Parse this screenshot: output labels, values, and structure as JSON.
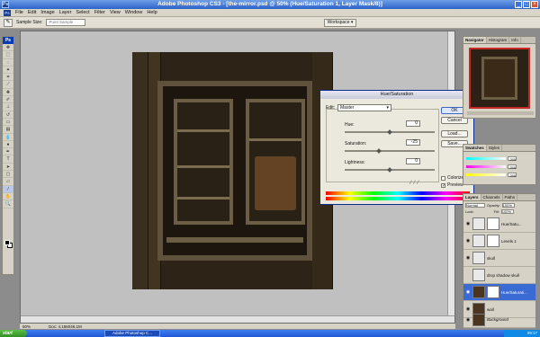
{
  "titlebar": {
    "logo": "Ps",
    "title": "Adobe Photoshop CS3 - [the-mirror.psd @ 50% (Hue/Saturation 1, Layer Mask/8)]"
  },
  "menus": [
    "File",
    "Edit",
    "Image",
    "Layer",
    "Select",
    "Filter",
    "View",
    "Window",
    "Help"
  ],
  "options": {
    "sample_size_label": "Sample Size:",
    "sample_size_value": "Point Sample",
    "workspace": "Workspace ▾"
  },
  "toolbox": {
    "header": "Ps"
  },
  "dialog": {
    "title": "Hue/Saturation",
    "edit_label": "Edit:",
    "edit_value": "Master",
    "hue_label": "Hue:",
    "hue_value": "0",
    "saturation_label": "Saturation:",
    "saturation_value": "-25",
    "lightness_label": "Lightness:",
    "lightness_value": "0",
    "ok": "OK",
    "cancel": "Cancel",
    "load": "Load...",
    "save": "Save...",
    "colorize": "Colorize",
    "preview": "Preview",
    "colorize_checked": false,
    "preview_checked": true
  },
  "navigator_panel": {
    "tabs": [
      "Navigator",
      "Histogram",
      "Info"
    ]
  },
  "color_panel": {
    "tabs": [
      "Swatches",
      "Styles"
    ],
    "values": [
      "255",
      "255",
      "255"
    ]
  },
  "layers_panel": {
    "tabs": [
      "Layers",
      "Channels",
      "Paths"
    ],
    "mode": "Normal",
    "opacity_label": "Opacity:",
    "opacity": "100%",
    "lock_label": "Lock:",
    "fill_label": "Fill:",
    "fill": "100%",
    "layers": [
      {
        "name": "Hue/Satu...",
        "selected": false
      },
      {
        "name": "Levels 1",
        "selected": false
      },
      {
        "name": "skull",
        "selected": false
      },
      {
        "name": "drop shadow skull",
        "selected": false
      },
      {
        "name": "Hue/Saturati...",
        "selected": true
      },
      {
        "name": "wall",
        "selected": false
      },
      {
        "name": "Background",
        "selected": false
      }
    ]
  },
  "status": {
    "zoom": "50%",
    "doc": "Doc: 4.15M/46.1M"
  },
  "taskbar": {
    "start": "start",
    "item": "Adobe Photoshop C...",
    "clock": "09:17"
  }
}
